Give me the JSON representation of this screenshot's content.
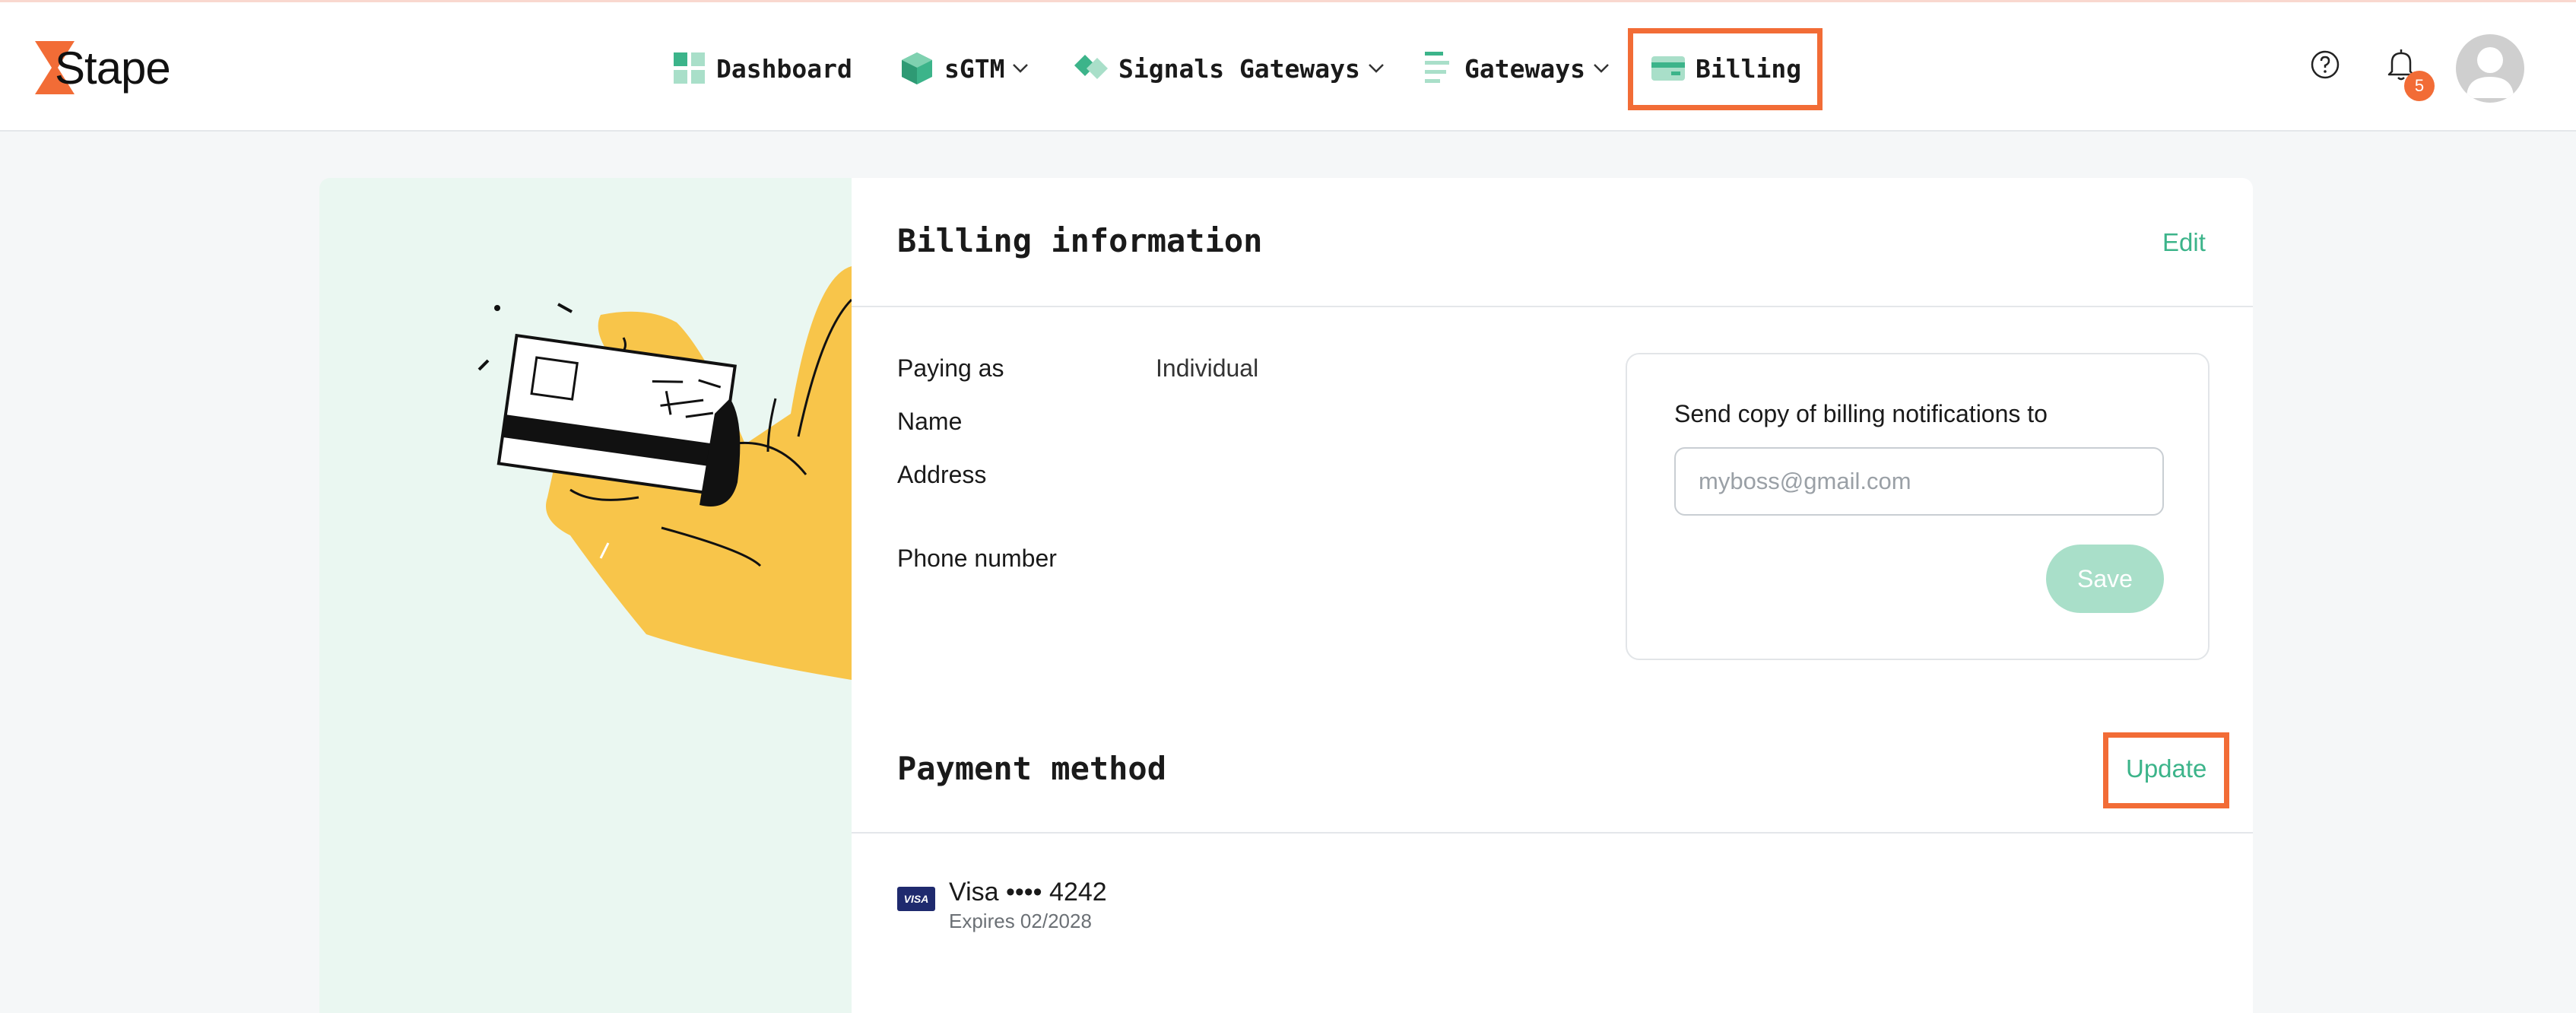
{
  "brand": {
    "name": "Stape",
    "accent": "#f26c36",
    "green": "#3cb48a"
  },
  "nav": {
    "items": [
      {
        "label": "Dashboard",
        "icon": "dashboard-grid-icon",
        "has_dropdown": false
      },
      {
        "label": "sGTM",
        "icon": "cube-icon",
        "has_dropdown": true
      },
      {
        "label": "Signals Gateways",
        "icon": "diamond-icon",
        "has_dropdown": true
      },
      {
        "label": "Gateways",
        "icon": "gateway-lines-icon",
        "has_dropdown": true
      },
      {
        "label": "Billing",
        "icon": "credit-card-icon",
        "has_dropdown": false,
        "active": true
      }
    ]
  },
  "header": {
    "notifications_count": "5",
    "help_icon": "help-circle-icon",
    "bell_icon": "bell-icon"
  },
  "billing_info": {
    "title": "Billing information",
    "edit_label": "Edit",
    "fields": [
      {
        "label": "Paying as",
        "value": "Individual"
      },
      {
        "label": "Name",
        "value": ""
      },
      {
        "label": "Address",
        "value": ""
      },
      {
        "label": "Phone number",
        "value": ""
      }
    ],
    "notifications": {
      "label": "Send copy of billing notifications to",
      "placeholder": "myboss@gmail.com",
      "value": "",
      "save_label": "Save"
    }
  },
  "payment_method": {
    "title": "Payment method",
    "update_label": "Update",
    "card": {
      "brand": "VISA",
      "number": "Visa •••• 4242",
      "expiry": "Expires 02/2028"
    }
  }
}
